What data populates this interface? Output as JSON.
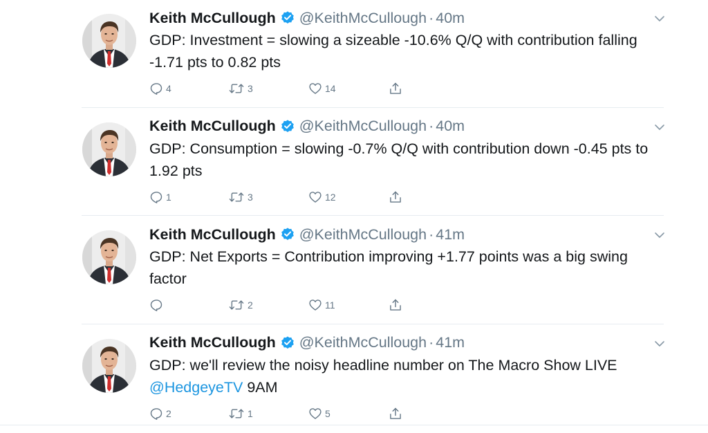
{
  "tweets": [
    {
      "name": "Keith McCullough",
      "handle": "@KeithMcCullough",
      "separator": "·",
      "time": "40m",
      "text": "GDP: Investment = slowing a sizeable -10.6% Q/Q with contribution falling -1.71 pts to 0.82 pts",
      "mention": "",
      "text_after": "",
      "replies": "4",
      "retweets": "3",
      "likes": "14"
    },
    {
      "name": "Keith McCullough",
      "handle": "@KeithMcCullough",
      "separator": "·",
      "time": "40m",
      "text": "GDP: Consumption = slowing -0.7% Q/Q with contribution down -0.45 pts to 1.92 pts",
      "mention": "",
      "text_after": "",
      "replies": "1",
      "retweets": "3",
      "likes": "12"
    },
    {
      "name": "Keith McCullough",
      "handle": "@KeithMcCullough",
      "separator": "·",
      "time": "41m",
      "text": "GDP: Net Exports = Contribution improving +1.77 points was a big swing factor",
      "mention": "",
      "text_after": "",
      "replies": "",
      "retweets": "2",
      "likes": "11"
    },
    {
      "name": "Keith McCullough",
      "handle": "@KeithMcCullough",
      "separator": "·",
      "time": "41m",
      "text": "GDP: we'll review the noisy headline number on The Macro Show LIVE ",
      "mention": "@HedgeyeTV",
      "text_after": " 9AM",
      "replies": "2",
      "retweets": "1",
      "likes": "5"
    }
  ],
  "icons": {
    "verified": "verified-badge-icon",
    "caret": "chevron-down-icon",
    "reply": "reply-icon",
    "retweet": "retweet-icon",
    "like": "heart-icon",
    "share": "share-icon"
  },
  "colors": {
    "text": "#14171a",
    "secondary": "#657786",
    "link": "#1b95e0",
    "verified": "#1da1f2",
    "divider": "#e6ecf0"
  }
}
